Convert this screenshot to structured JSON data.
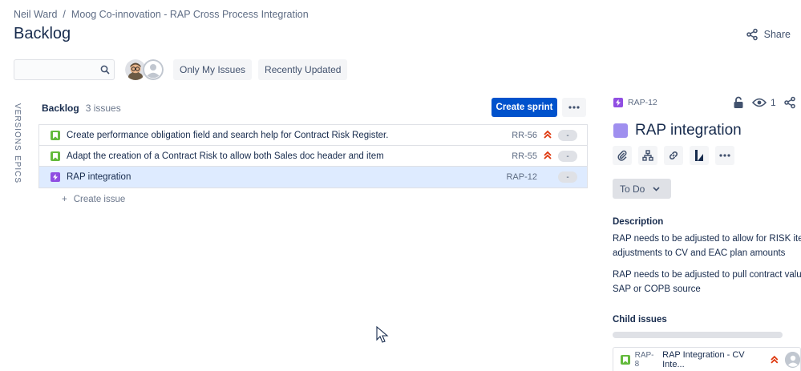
{
  "breadcrumb": {
    "items": [
      "Neil Ward",
      "Moog Co-innovation - RAP Cross Process Integration"
    ],
    "separator": "/"
  },
  "page": {
    "title": "Backlog",
    "share_label": "Share"
  },
  "filters": {
    "search_placeholder": "",
    "quick_filters": [
      "Only My Issues",
      "Recently Updated"
    ]
  },
  "side_tabs": [
    "VERSIONS",
    "EPICS"
  ],
  "backlog": {
    "name": "Backlog",
    "count_label": "3 issues",
    "create_sprint_label": "Create sprint",
    "issues": [
      {
        "type": "story",
        "summary": "Create performance obligation field and search help for Contract Risk Register.",
        "key": "RR-56",
        "priority": "highest",
        "estimate": "-"
      },
      {
        "type": "story",
        "summary": "Adapt the creation of a Contract Risk to allow both Sales doc header and item",
        "key": "RR-55",
        "priority": "highest",
        "estimate": "-"
      },
      {
        "type": "epic",
        "summary": "RAP integration",
        "key": "RAP-12",
        "priority": "",
        "estimate": "-"
      }
    ],
    "create_issue_label": "Create issue"
  },
  "detail": {
    "key": "RAP-12",
    "watch_count": "1",
    "title": "RAP integration",
    "status": "To Do",
    "description_heading": "Description",
    "description": [
      "RAP needs to be adjusted to allow for RISK item",
      "adjustments to CV and EAC plan amounts",
      "RAP needs to be adjusted to pull contract value f",
      "SAP or COPB source"
    ],
    "child_heading": "Child issues",
    "child": {
      "key": "RAP-8",
      "summary": "RAP Integration - CV Inte..."
    }
  },
  "colors": {
    "primary": "#0052cc",
    "story": "#63ba3c",
    "epic": "#904ee2",
    "priority": "#de350b",
    "selected_row": "#deebff"
  }
}
